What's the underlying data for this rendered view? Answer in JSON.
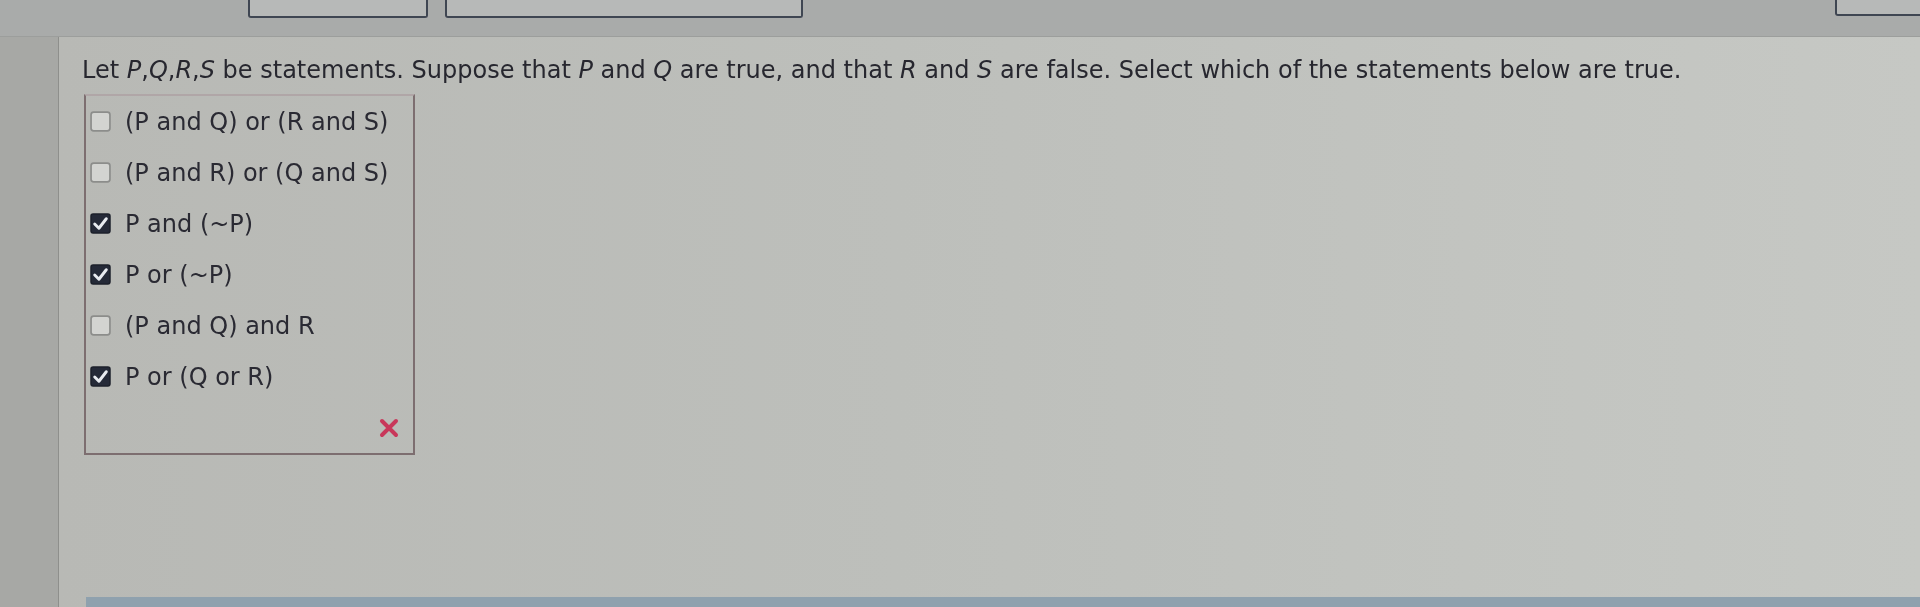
{
  "question": "Let *P*,*Q*,*R*,*S* be statements. Suppose that *P* and *Q* are true, and that *R* and *S* are false. Select which of the statements below are true.",
  "options": [
    {
      "label": "(P and Q) or (R and S)",
      "checked": false
    },
    {
      "label": "(P and R) or (Q and S)",
      "checked": false
    },
    {
      "label": "P and (~P)",
      "checked": true
    },
    {
      "label": "P or (~P)",
      "checked": true
    },
    {
      "label": "(P and Q) and R",
      "checked": false
    },
    {
      "label": "P or (Q or R)",
      "checked": true
    }
  ],
  "feedback": {
    "kind": "incorrect"
  }
}
